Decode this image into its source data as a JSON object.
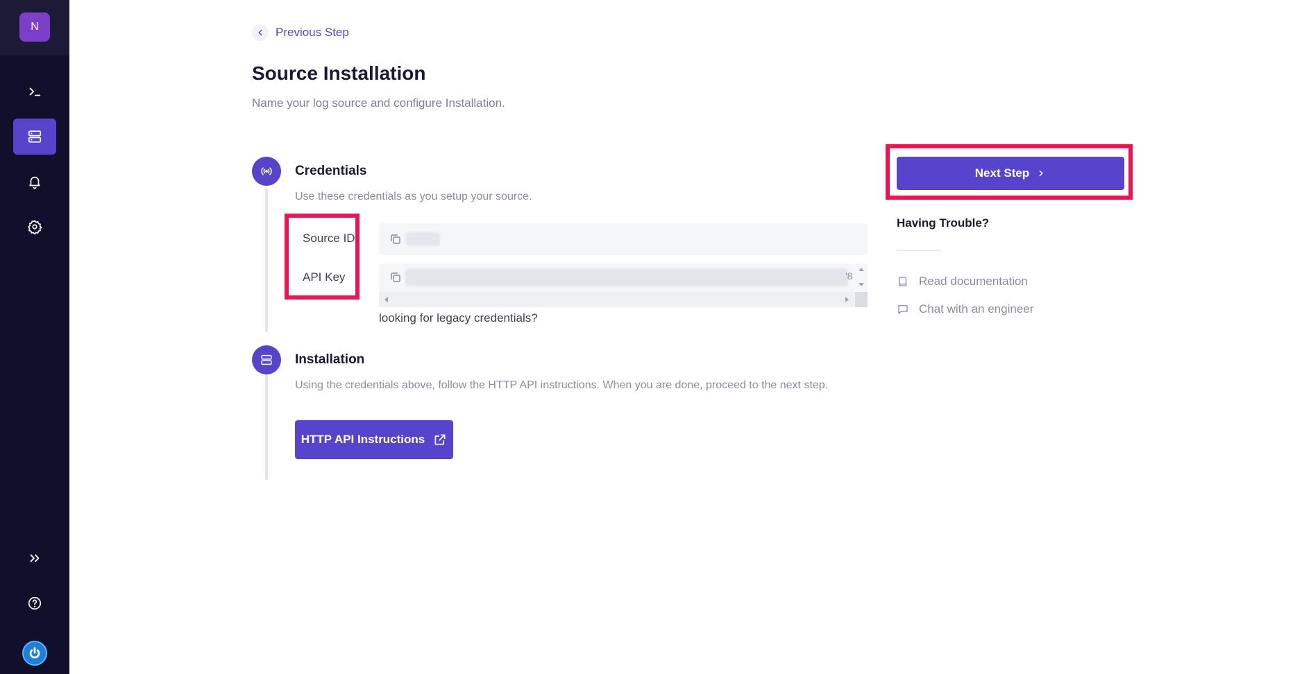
{
  "sidebar": {
    "avatar_initial": "N",
    "items": [
      {
        "icon": "terminal-icon",
        "active": false
      },
      {
        "icon": "server-icon",
        "active": true
      },
      {
        "icon": "bell-icon",
        "active": false
      },
      {
        "icon": "gear-icon",
        "active": false
      }
    ],
    "bottom_items": [
      {
        "icon": "chevrons-right-icon"
      },
      {
        "icon": "help-circle-icon"
      },
      {
        "icon": "power-logo-icon"
      }
    ]
  },
  "header": {
    "back_label": "Previous Step",
    "title": "Source Installation",
    "subtitle": "Name your log source and configure Installation."
  },
  "steps": {
    "credentials": {
      "title": "Credentials",
      "description": "Use these credentials as you setup your source.",
      "source_id_label": "Source ID",
      "api_key_label": "API Key",
      "api_key_visible_suffix": "'8",
      "legacy_link": "looking for legacy credentials?"
    },
    "installation": {
      "title": "Installation",
      "description": "Using the credentials above, follow the HTTP API instructions. When you are done, proceed to the next step.",
      "button_label": "HTTP API Instructions"
    }
  },
  "aside": {
    "next_label": "Next Step",
    "trouble_title": "Having Trouble?",
    "links": [
      {
        "label": "Read documentation",
        "icon": "book-icon"
      },
      {
        "label": "Chat with an engineer",
        "icon": "chat-bubble-icon"
      }
    ]
  },
  "colors": {
    "sidebar_bg": "#120f2d",
    "accent": "#5645cc",
    "highlight": "#ee1452",
    "avatar_bg": "#7c3fc9"
  }
}
